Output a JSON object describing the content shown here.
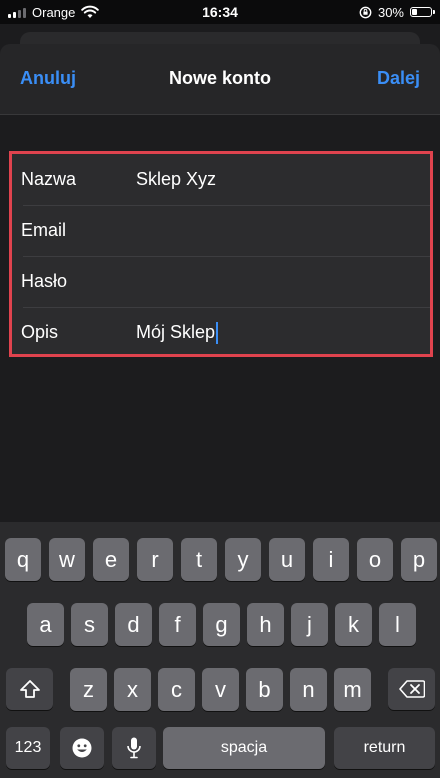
{
  "status_bar": {
    "carrier": "Orange",
    "time": "16:34",
    "battery_percent_label": "30%",
    "battery_level": 0.3,
    "icons": [
      "signal-icon",
      "wifi-icon",
      "orientation-lock-icon",
      "battery-icon"
    ]
  },
  "nav": {
    "cancel_label": "Anuluj",
    "title": "Nowe konto",
    "next_label": "Dalej",
    "accent_color": "#3a8ef6"
  },
  "form": {
    "highlight_color": "#e0434e",
    "fields": [
      {
        "label": "Nazwa",
        "value": "Sklep Xyz"
      },
      {
        "label": "Email",
        "value": ""
      },
      {
        "label": "Hasło",
        "value": ""
      },
      {
        "label": "Opis",
        "value": "Mój Sklep"
      }
    ]
  },
  "keyboard": {
    "row1": [
      "q",
      "w",
      "e",
      "r",
      "t",
      "y",
      "u",
      "i",
      "o",
      "p"
    ],
    "row2": [
      "a",
      "s",
      "d",
      "f",
      "g",
      "h",
      "j",
      "k",
      "l"
    ],
    "row3": [
      "z",
      "x",
      "c",
      "v",
      "b",
      "n",
      "m"
    ],
    "numbers_label": "123",
    "space_label": "spacja",
    "return_label": "return",
    "icons": [
      "shift-icon",
      "backspace-icon",
      "emoji-icon",
      "microphone-icon"
    ]
  }
}
